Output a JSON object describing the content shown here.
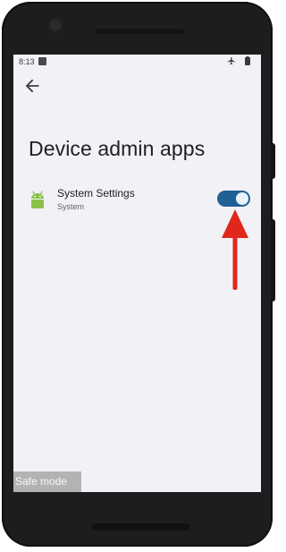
{
  "status_bar": {
    "time": "8:13",
    "notification_icon": "n-icon",
    "airplane_icon": "airplane-icon",
    "battery_icon": "battery-icon"
  },
  "header": {
    "back_icon": "arrow-back-icon",
    "title": "Device admin apps"
  },
  "apps": [
    {
      "icon": "android-icon",
      "name": "System Settings",
      "subtitle": "System",
      "enabled": true
    }
  ],
  "overlay": {
    "safe_mode_label": "Safe mode"
  },
  "colors": {
    "toggle_on": "#1f6095",
    "annotation_arrow": "#e0271b",
    "android_green": "#8bc34a",
    "screen_background": "#f2f1f5"
  }
}
